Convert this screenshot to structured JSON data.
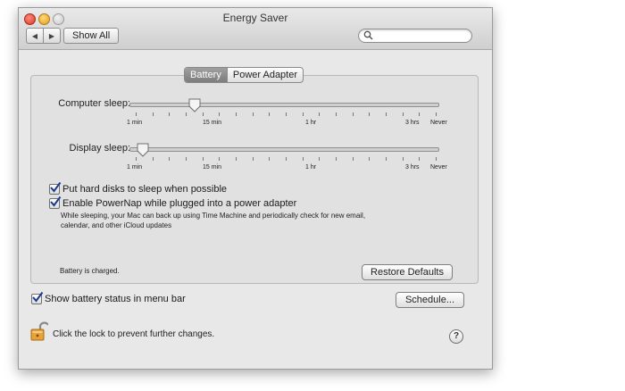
{
  "window": {
    "title": "Energy Saver",
    "back_glyph": "◀",
    "forward_glyph": "▶",
    "show_all_label": "Show All",
    "search_placeholder": ""
  },
  "tabs": [
    {
      "label": "Battery",
      "selected": true
    },
    {
      "label": "Power Adapter",
      "selected": false
    }
  ],
  "computer_sleep": {
    "label": "Computer sleep:",
    "value": "10 min",
    "ticks": [
      "1 min",
      "15 min",
      "1 hr",
      "3 hrs",
      "Never"
    ]
  },
  "display_sleep": {
    "label": "Display sleep:",
    "value": "2 min",
    "ticks": [
      "1 min",
      "15 min",
      "1 hr",
      "3 hrs",
      "Never"
    ]
  },
  "options": {
    "hard_disks": {
      "label": "Put hard disks to sleep when possible",
      "checked": true
    },
    "powernap": {
      "label": "Enable PowerNap while plugged into a power adapter",
      "checked": true,
      "description_line1": "While sleeping, your Mac can back up using Time Machine and periodically check for new email,",
      "description_line2": "calendar, and other iCloud updates"
    }
  },
  "status": {
    "battery_text": "Battery is charged."
  },
  "buttons": {
    "restore_defaults": "Restore Defaults",
    "schedule": "Schedule..."
  },
  "menu_bar_option": {
    "label": "Show battery status in menu bar",
    "checked": true
  },
  "lock": {
    "text": "Click the lock to prevent further changes."
  },
  "help": {
    "label": "?"
  },
  "colors": {
    "window_bg": "#e8e8e8",
    "selected_tab": "#8a8a8a",
    "checkmark": "#1c3a8c"
  }
}
